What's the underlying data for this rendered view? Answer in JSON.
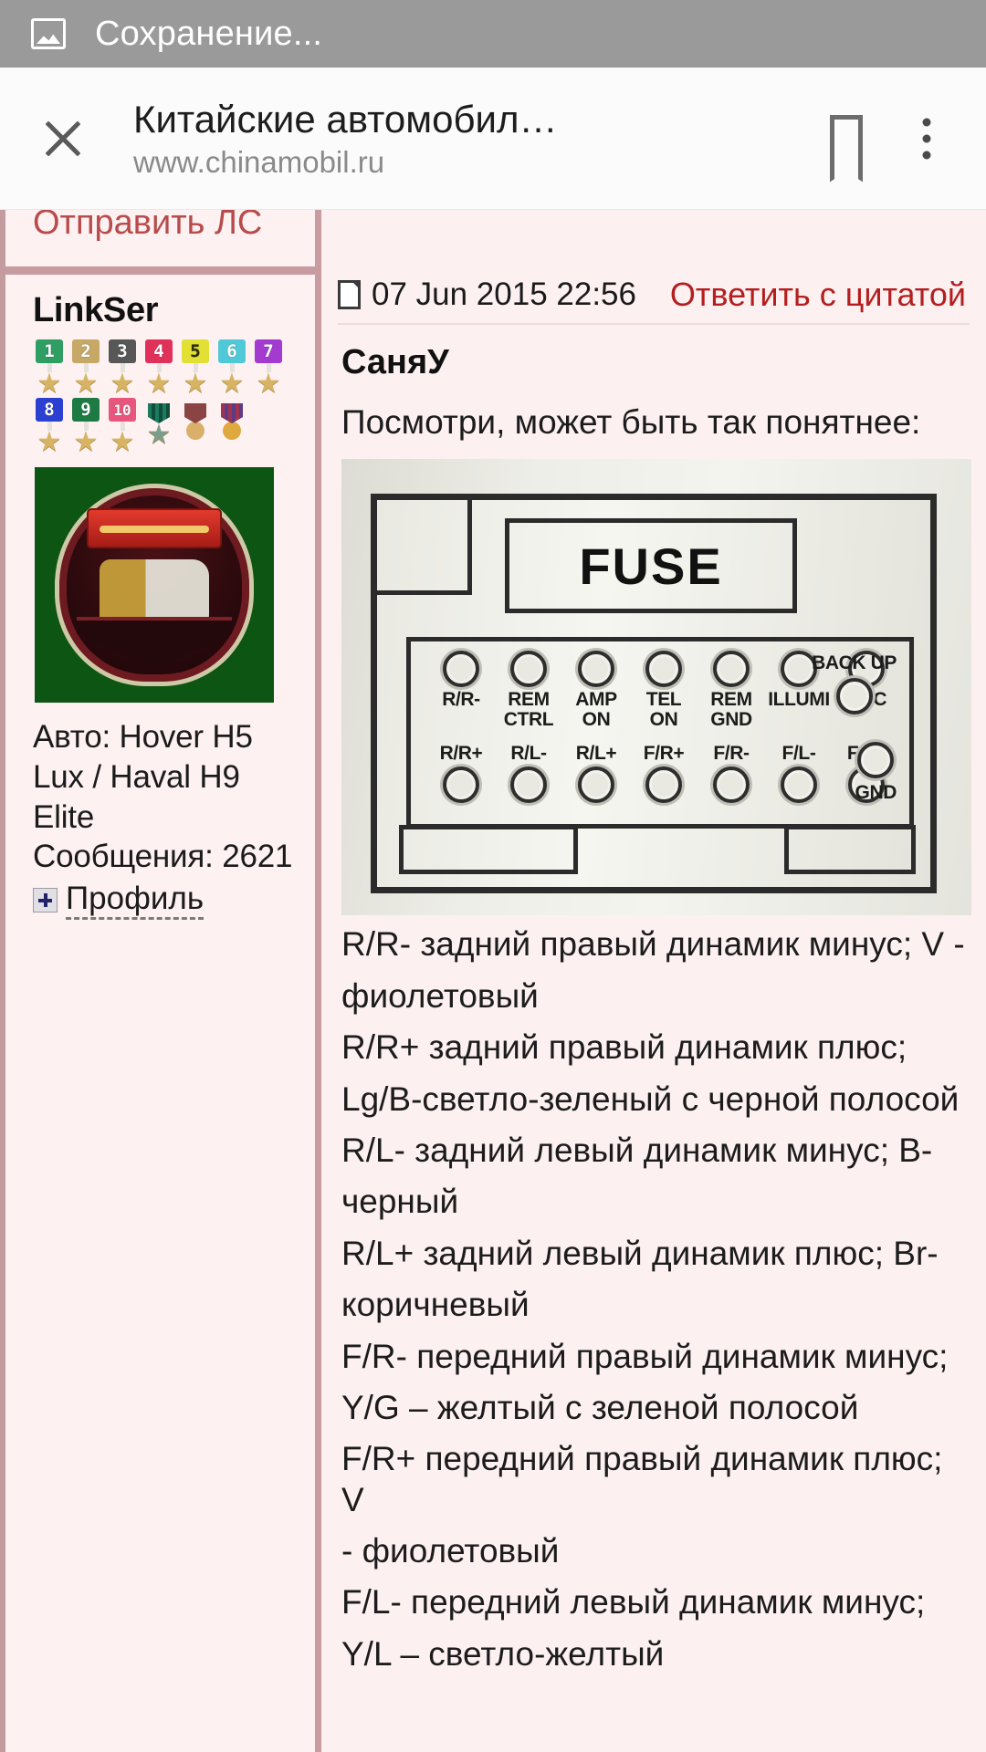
{
  "statusbar": {
    "text": "Сохранение...",
    "icon": "image-icon",
    "bg_color": "#9a9a9a"
  },
  "toolbar": {
    "close_icon": "close-icon",
    "title": "Китайские автомобил…",
    "url": "www.chinamobil.ru",
    "bookmark_icon": "bookmark-icon",
    "menu_icon": "overflow-menu-icon"
  },
  "forum": {
    "cut_text": "Отправить ЛС",
    "author": {
      "name": "LinkSer",
      "badges_row1": [
        {
          "label": "1",
          "color": "#2e9e63"
        },
        {
          "label": "2",
          "color": "#c6a867"
        },
        {
          "label": "3",
          "color": "#575757"
        },
        {
          "label": "4",
          "color": "#e0315b"
        },
        {
          "label": "5",
          "color": "#e2e034"
        },
        {
          "label": "6",
          "color": "#4fc9d8"
        },
        {
          "label": "7",
          "color": "#a33bd0"
        }
      ],
      "badges_row2": [
        {
          "label": "8",
          "color": "#2b3fd0"
        },
        {
          "label": "9",
          "color": "#1d7a43"
        },
        {
          "label": "10",
          "color": "#e8567d"
        },
        {
          "label": "",
          "color": "#1d7a5e"
        },
        {
          "label": "",
          "color": "#8a4444"
        },
        {
          "label": "",
          "color": "#a0344e"
        }
      ],
      "avatar_alt": "emblem-avatar",
      "car_line1": "Авто: Hover H5",
      "car_line2": "Lux / Haval H9",
      "car_line3": "Elite",
      "messages": "Сообщения: 2621",
      "profile_label": "Профиль"
    },
    "post": {
      "date": "07 Jun 2015 22:56",
      "quote_link": "Ответить с цитатой",
      "poster": "СаняУ",
      "intro": "Посмотри, может быть так понятнее:",
      "image": {
        "alt": "car-stereo-connector-photo",
        "fuse_label": "FUSE",
        "pins_top": [
          {
            "label": "R/R-"
          },
          {
            "label": "REM\nCTRL"
          },
          {
            "label": "AMP\nON"
          },
          {
            "label": "TEL\nON"
          },
          {
            "label": "REM\nGND"
          },
          {
            "label": "ILLUMI"
          },
          {
            "label": "ACC"
          }
        ],
        "pin_backup": "BACK UP",
        "pins_bottom": [
          {
            "label": "R/R+"
          },
          {
            "label": "R/L-"
          },
          {
            "label": "R/L+"
          },
          {
            "label": "F/R+"
          },
          {
            "label": "F/R-"
          },
          {
            "label": "F/L-"
          },
          {
            "label": "F/L+"
          }
        ],
        "pin_gnd": "GND"
      },
      "lines": [
        "R/R- задний правый динамик минус; V -",
        "фиолетовый",
        "R/R+ задний правый динамик плюс;",
        "Lg/B-светло-зеленый с черной полосой",
        "R/L- задний левый динамик минус; B-",
        "черный",
        "R/L+ задний левый динамик плюс; Br-",
        "коричневый",
        "F/R- передний правый динамик минус;",
        "Y/G – желтый с зеленой полосой",
        "F/R+ передний правый динамик плюс; V",
        "- фиолетовый",
        "F/L- передний левый динамик минус;",
        "Y/L – светло-желтый"
      ]
    }
  }
}
